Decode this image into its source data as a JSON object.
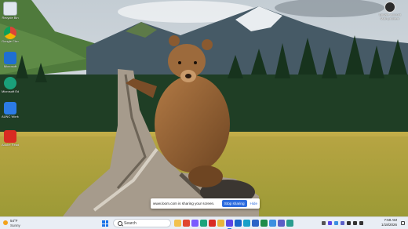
{
  "desktop_icons": [
    {
      "label": "Recycle Bin",
      "color": "#dfe6ee"
    },
    {
      "label": "Google Chrome",
      "color": "#ffffff"
    },
    {
      "label": "Microsoft",
      "color": "#1f6fd1"
    },
    {
      "label": "Microsoft Edge",
      "color": "#1aa07a"
    },
    {
      "label": "AUNC Workspace",
      "color": "#2c7be5"
    },
    {
      "label": "Adobe Reader",
      "color": "#d92b22"
    }
  ],
  "account": {
    "line1": "Update account",
    "line2": "Main problem"
  },
  "share_bar": {
    "message": "www.loom.com is sharing your screen.",
    "stop_label": "Stop sharing",
    "hide_label": "Hide"
  },
  "taskbar": {
    "weather": {
      "temp": "54°F",
      "condition": "Sunny"
    },
    "search_placeholder": "Search",
    "apps": [
      {
        "name": "file-explorer-icon",
        "color": "#f2c14e"
      },
      {
        "name": "chrome-icon",
        "color": "#e0452f"
      },
      {
        "name": "copilot-icon",
        "color": "#7a5cff"
      },
      {
        "name": "edge-icon",
        "color": "#1ba37b"
      },
      {
        "name": "adobe-acrobat-icon",
        "color": "#d92b22"
      },
      {
        "name": "folder-icon",
        "color": "#e9b43c"
      },
      {
        "name": "loom-icon",
        "color": "#5b45e6"
      },
      {
        "name": "outlook-icon",
        "color": "#1a66c9"
      },
      {
        "name": "edge-icon",
        "color": "#18a0c9"
      },
      {
        "name": "word-icon",
        "color": "#2b62c6"
      },
      {
        "name": "excel-icon",
        "color": "#1e8b4a"
      },
      {
        "name": "onedrive-icon",
        "color": "#3c8fe0"
      },
      {
        "name": "teams-icon",
        "color": "#5b5fc7"
      },
      {
        "name": "app-icon",
        "color": "#2a9d8f"
      }
    ],
    "tray": [
      {
        "name": "chevron-up-icon",
        "color": "#555555"
      },
      {
        "name": "loom-tray-icon",
        "color": "#5b45e6"
      },
      {
        "name": "onedrive-tray-icon",
        "color": "#3c8fe0"
      },
      {
        "name": "teams-tray-icon",
        "color": "#5b5fc7"
      },
      {
        "name": "wifi-icon",
        "color": "#333333"
      },
      {
        "name": "speaker-icon",
        "color": "#333333"
      },
      {
        "name": "battery-icon",
        "color": "#333333"
      }
    ],
    "time": "7:59 AM",
    "date": "1/18/2026"
  }
}
